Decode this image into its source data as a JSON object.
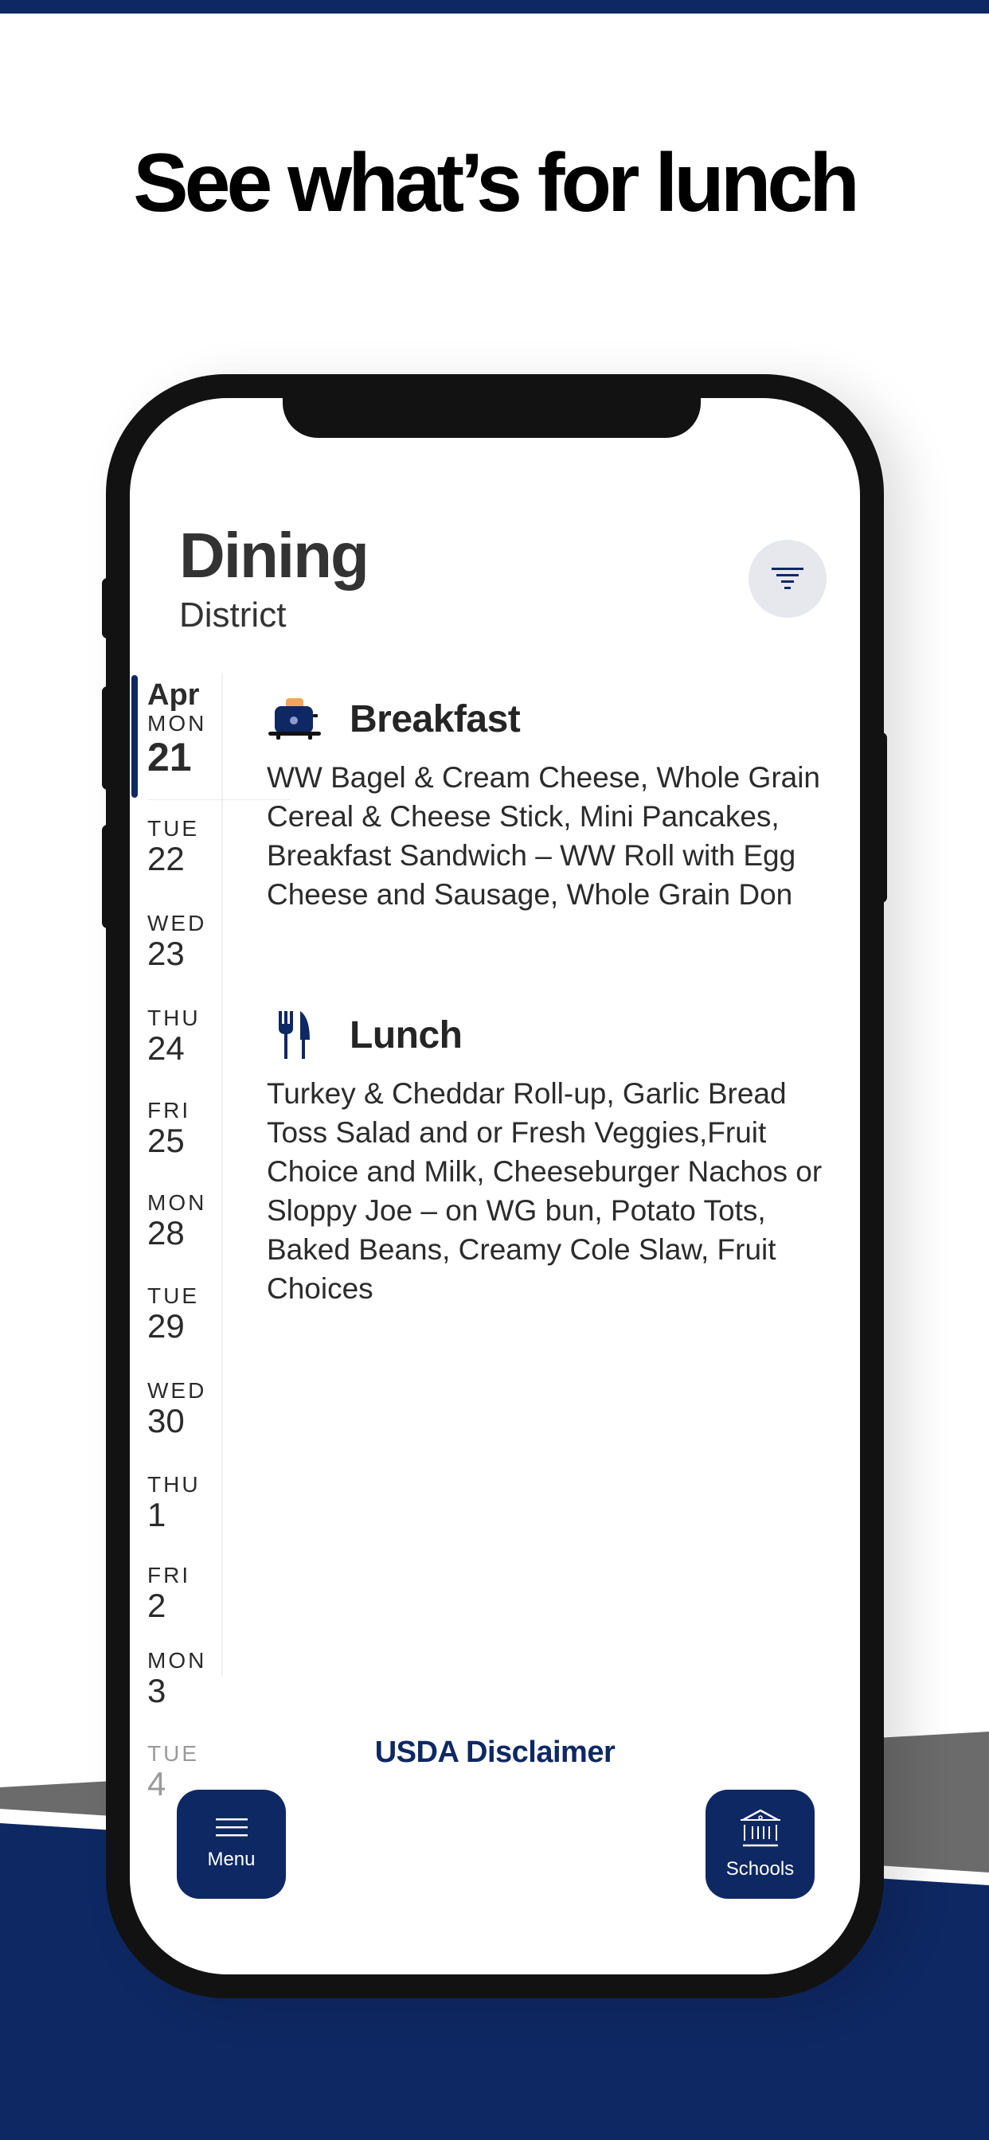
{
  "marketing": {
    "headline": "See what’s for lunch"
  },
  "colors": {
    "brand_navy": "#0e2863",
    "band_gray": "#6b6b6b",
    "filter_bg": "#e6e8ee",
    "toast_orange": "#f2a65a"
  },
  "app": {
    "title": "Dining",
    "subtitle": "District",
    "filter_icon": "filter-icon"
  },
  "date_rail": {
    "month": "Apr",
    "dates": [
      {
        "dow": "MON",
        "day": "21",
        "active": true
      },
      {
        "dow": "TUE",
        "day": "22"
      },
      {
        "dow": "WED",
        "day": "23"
      },
      {
        "dow": "THU",
        "day": "24"
      },
      {
        "dow": "FRI",
        "day": "25"
      },
      {
        "dow": "MON",
        "day": "28"
      },
      {
        "dow": "TUE",
        "day": "29"
      },
      {
        "dow": "WED",
        "day": "30"
      },
      {
        "dow": "THU",
        "day": "1"
      },
      {
        "dow": "FRI",
        "day": "2"
      },
      {
        "dow": "MON",
        "day": "3"
      },
      {
        "dow": "TUE",
        "day": "4"
      }
    ]
  },
  "meals": [
    {
      "icon": "toaster-icon",
      "title": "Breakfast",
      "description": "WW Bagel & Cream Cheese, Whole Grain Cereal & Cheese Stick, Mini Pancakes, Breakfast Sandwich – WW Roll with Egg Cheese and Sausage, Whole Grain Don"
    },
    {
      "icon": "fork-knife-icon",
      "title": "Lunch",
      "description": "Turkey & Cheddar Roll-up, Garlic Bread Toss Salad and or Fresh Veggies,Fruit Choice and Milk, Cheeseburger Nachos or Sloppy Joe – on WG bun, Potato Tots, Baked Beans, Creamy Cole Slaw, Fruit Choices"
    }
  ],
  "footer": {
    "disclaimer_link": "USDA Disclaimer",
    "menu_button": {
      "label": "Menu",
      "icon": "hamburger-icon"
    },
    "schools_button": {
      "label": "Schools",
      "icon": "school-building-icon"
    }
  }
}
